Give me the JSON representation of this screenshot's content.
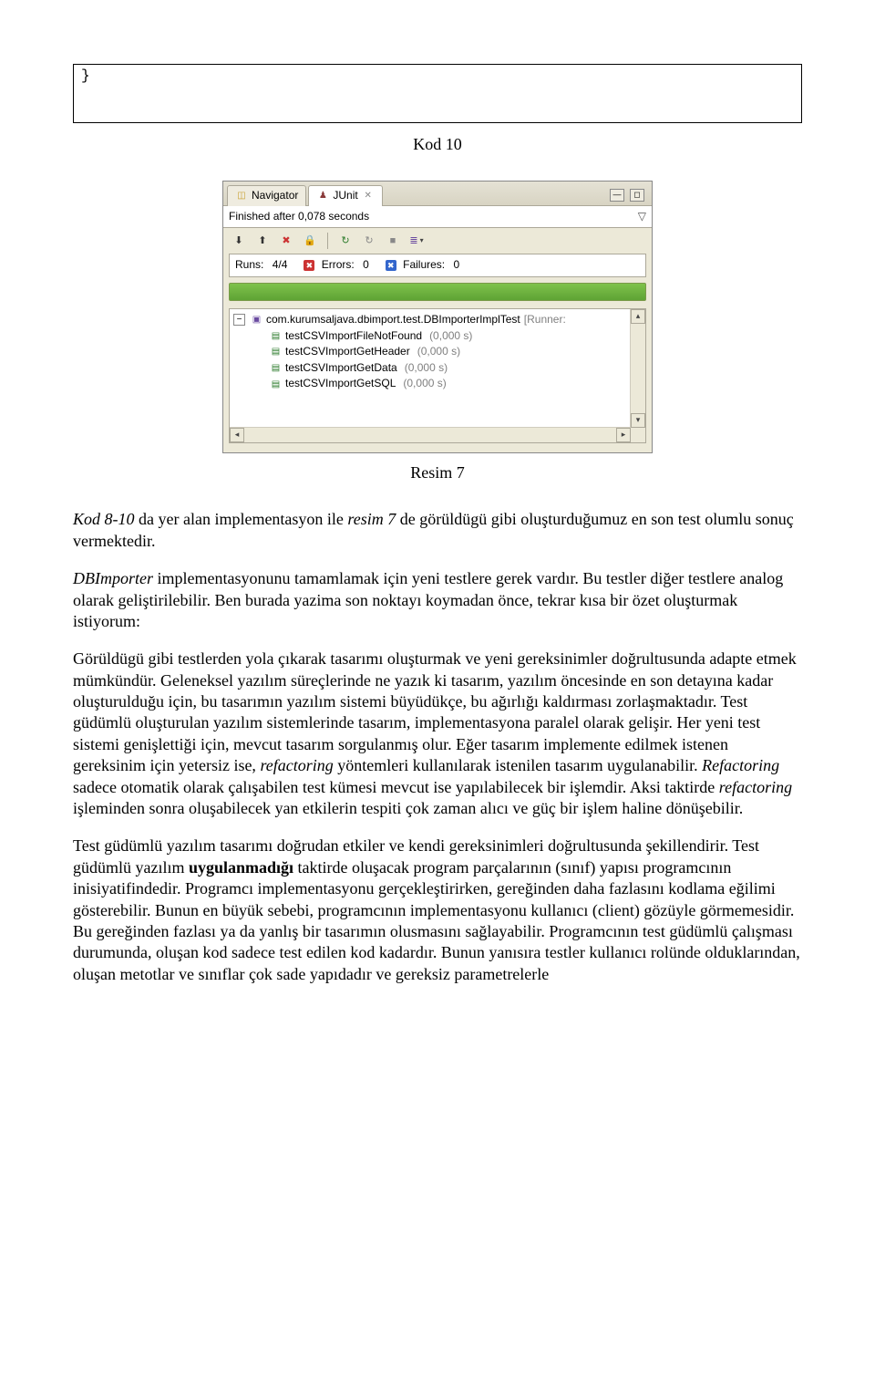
{
  "code_box": {
    "text": "}"
  },
  "caption_code": "Kod 10",
  "caption_image": "Resim 7",
  "junit": {
    "tabs": {
      "navigator": "Navigator",
      "junit": "JUnit"
    },
    "status_text": "Finished after 0,078 seconds",
    "runs_label": "Runs:",
    "runs_value": "4/4",
    "errors_label": "Errors:",
    "errors_value": "0",
    "failures_label": "Failures:",
    "failures_value": "0",
    "tree": {
      "root_name": "com.kurumsaljava.dbimport.test.DBImporterImplTest",
      "root_suffix": " [Runner: ",
      "items": [
        {
          "name": "testCSVImportFileNotFound",
          "time": "(0,000 s)"
        },
        {
          "name": "testCSVImportGetHeader",
          "time": "(0,000 s)"
        },
        {
          "name": "testCSVImportGetData",
          "time": "(0,000 s)"
        },
        {
          "name": "testCSVImportGetSQL",
          "time": "(0,000 s)"
        }
      ]
    }
  },
  "para1": {
    "pre1": "Kod 8-10",
    "mid1": " da yer alan implementasyon ile ",
    "pre2": "resim 7",
    "mid2": " de görüldügü gibi oluşturduğumuz en son test olumlu sonuç vermektedir."
  },
  "para2": {
    "pre1": "DBImporter",
    "mid1": " implementasyonunu tamamlamak için yeni testlere gerek vardır. Bu testler diğer testlere analog olarak geliştirilebilir. Ben burada yazima son noktayı koymadan önce, tekrar kısa bir özet oluşturmak istiyorum:"
  },
  "para3": {
    "t1": "Görüldügü gibi testlerden yola çıkarak tasarımı oluşturmak ve yeni gereksinimler doğrultusunda adapte etmek mümkündür. Geleneksel yazılım süreçlerinde ne yazık ki tasarım, yazılım öncesinde en son detayına kadar oluşturulduğu için, bu tasarımın yazılım sistemi büyüdükçe, bu ağırlığı kaldırması zorlaşmaktadır. Test güdümlü oluşturulan yazılım sistemlerinde tasarım, implementasyona paralel olarak gelişir. Her yeni test sistemi genişlettiği için, mevcut tasarım sorgulanmış olur. Eğer tasarım implemente edilmek istenen gereksinim için yetersiz ise, ",
    "i1": "refactoring",
    "t2": " yöntemleri  kullanılarak istenilen tasarım uygulanabilir. ",
    "i2": "Refactoring",
    "t3": " sadece otomatik olarak çalışabilen test kümesi mevcut ise yapılabilecek bir işlemdir. Aksi taktirde ",
    "i3": "refactoring",
    "t4": " işleminden sonra oluşabilecek yan etkilerin tespiti çok zaman alıcı ve güç bir işlem haline dönüşebilir."
  },
  "para4": {
    "t1": "Test güdümlü yazılım tasarımı doğrudan etkiler ve kendi gereksinimleri doğrultusunda şekillendirir. Test güdümlü yazılım ",
    "b1": "uygulanmadığı",
    "t2": " taktirde oluşacak program parçalarının (sınıf) yapısı programcının inisiyatifindedir. Programcı implementasyonu gerçekleştirirken, gereğinden daha fazlasını kodlama eğilimi gösterebilir. Bunun en büyük sebebi, programcının implementasyonu kullanıcı (client) gözüyle görmemesidir. Bu gereğinden fazlası ya da yanlış bir tasarımın olusmasını sağlayabilir. Programcının test güdümlü çalışması durumunda, oluşan kod sadece test edilen kod kadardır. Bunun yanısıra testler kullanıcı rolünde olduklarından, oluşan metotlar ve sınıflar çok sade yapıdadır ve gereksiz parametrelerle"
  }
}
